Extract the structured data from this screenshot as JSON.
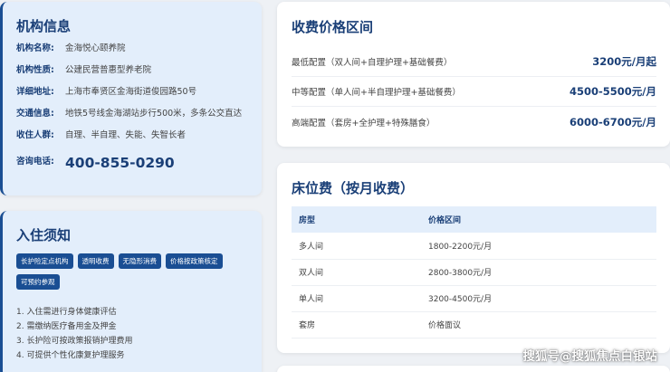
{
  "org_info": {
    "title": "机构信息",
    "rows": [
      {
        "label": "机构名称:",
        "value": "金海悦心颐养院"
      },
      {
        "label": "机构性质:",
        "value": "公建民营普惠型养老院"
      },
      {
        "label": "详细地址:",
        "value": "上海市奉贤区金海街道俊园路50号"
      },
      {
        "label": "交通信息:",
        "value": "地铁5号线金海湖站步行500米，多条公交直达"
      },
      {
        "label": "收住人群:",
        "value": "自理、半自理、失能、失智长者"
      }
    ],
    "phone_label": "咨询电话:",
    "phone": "400-855-0290"
  },
  "admission": {
    "title": "入住须知",
    "tags": [
      "长护险定点机构",
      "透明收费",
      "无隐形消费",
      "价格按政策核定",
      "可预约参观"
    ],
    "notes": [
      "1. 入住需进行身体健康评估",
      "2. 需缴纳医疗备用金及押金",
      "3. 长护险可按政策报销护理费用",
      "4. 可提供个性化康复护理服务"
    ]
  },
  "price_range": {
    "title": "收费价格区间",
    "rows": [
      {
        "name": "最低配置（双人间+自理护理+基础餐费）",
        "value": "3200元/月起"
      },
      {
        "name": "中等配置（单人间+半自理护理+基础餐费）",
        "value": "4500-5500元/月"
      },
      {
        "name": "高端配置（套房+全护理+特殊膳食）",
        "value": "6000-6700元/月"
      }
    ]
  },
  "bed_fee": {
    "title": "床位费（按月收费）",
    "headers": [
      "房型",
      "价格区间"
    ],
    "rows": [
      [
        "多人间",
        "1800-2200元/月"
      ],
      [
        "双人间",
        "2800-3800元/月"
      ],
      [
        "单人间",
        "3200-4500元/月"
      ],
      [
        "套房",
        "价格面议"
      ]
    ]
  },
  "watermark": "搜狐号@搜狐焦点白银站",
  "colors": {
    "accent": "#1a3f77",
    "tag_bg": "#1a4e93",
    "left_card_bg": "#e3eefb"
  }
}
